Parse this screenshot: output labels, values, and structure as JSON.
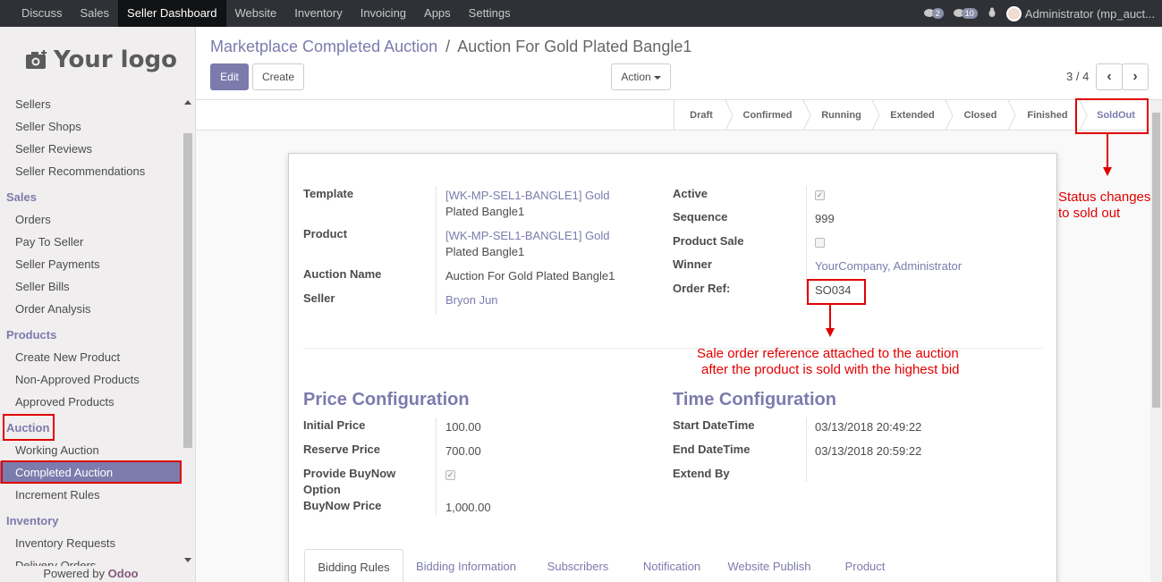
{
  "topbar": {
    "menus": [
      "Discuss",
      "Sales",
      "Seller Dashboard",
      "Website",
      "Inventory",
      "Invoicing",
      "Apps",
      "Settings"
    ],
    "active_menu": "Seller Dashboard",
    "chat_badge": "2",
    "messages_badge": "10",
    "user": "Administrator (mp_auct..."
  },
  "sidebar": {
    "logo_text": "Your logo",
    "top_items": [
      "Sellers",
      "Seller Shops",
      "Seller Reviews",
      "Seller Recommendations"
    ],
    "sales_title": "Sales",
    "sales_items": [
      "Orders",
      "Pay To Seller",
      "Seller Payments",
      "Seller Bills",
      "Order Analysis"
    ],
    "products_title": "Products",
    "products_items": [
      "Create New Product",
      "Non-Approved Products",
      "Approved Products"
    ],
    "auction_title": "Auction",
    "auction_items": [
      "Working Auction",
      "Completed Auction",
      "Increment Rules"
    ],
    "inventory_title": "Inventory",
    "inventory_items": [
      "Inventory Requests",
      "Delivery Orders"
    ],
    "powered_by": "Powered by",
    "powered_brand": "Odoo"
  },
  "control": {
    "breadcrumb_parent": "Marketplace Completed Auction",
    "breadcrumb_sep": "/",
    "breadcrumb_current": "Auction For Gold Plated Bangle1",
    "edit_label": "Edit",
    "create_label": "Create",
    "action_label": "Action",
    "pager": "3 / 4"
  },
  "statusbar": {
    "stages": [
      "Draft",
      "Confirmed",
      "Running",
      "Extended",
      "Closed",
      "Finished",
      "SoldOut"
    ],
    "current": "SoldOut"
  },
  "form": {
    "template_label": "Template",
    "template_ref": "[WK-MP-SEL1-BANGLE1] Gold",
    "template_name": "Plated Bangle1",
    "product_label": "Product",
    "product_ref": "[WK-MP-SEL1-BANGLE1] Gold",
    "product_name": "Plated Bangle1",
    "auction_name_label": "Auction Name",
    "auction_name": "Auction For Gold Plated Bangle1",
    "seller_label": "Seller",
    "seller": "Bryon Jun",
    "active_label": "Active",
    "active": true,
    "sequence_label": "Sequence",
    "sequence": "999",
    "product_sale_label": "Product Sale",
    "product_sale": false,
    "winner_label": "Winner",
    "winner": "YourCompany, Administrator",
    "order_ref_label": "Order Ref:",
    "order_ref": "SO034",
    "price_title": "Price Configuration",
    "initial_price_label": "Initial Price",
    "initial_price": "100.00",
    "reserve_price_label": "Reserve Price",
    "reserve_price": "700.00",
    "buynow_option_label_1": "Provide BuyNow",
    "buynow_option_label_2": "Option",
    "buynow_option": true,
    "buynow_price_label": "BuyNow Price",
    "buynow_price": "1,000.00",
    "time_title": "Time Configuration",
    "start_label": "Start DateTime",
    "start": "03/13/2018 20:49:22",
    "end_label": "End DateTime",
    "end": "03/13/2018 20:59:22",
    "extend_label": "Extend By"
  },
  "tabs": [
    "Bidding Rules",
    "Bidding Information",
    "Subscribers",
    "Notification",
    "Website Publish",
    "Product"
  ],
  "annotations": {
    "status_note_1": "Status changes",
    "status_note_2": "to sold out",
    "order_note_1": "Sale order reference attached to the auction",
    "order_note_2": "after the product is sold with the highest bid"
  },
  "colors": {
    "accent": "#7c7bad",
    "annotation": "#e10000",
    "topbar": "#2f3136"
  }
}
